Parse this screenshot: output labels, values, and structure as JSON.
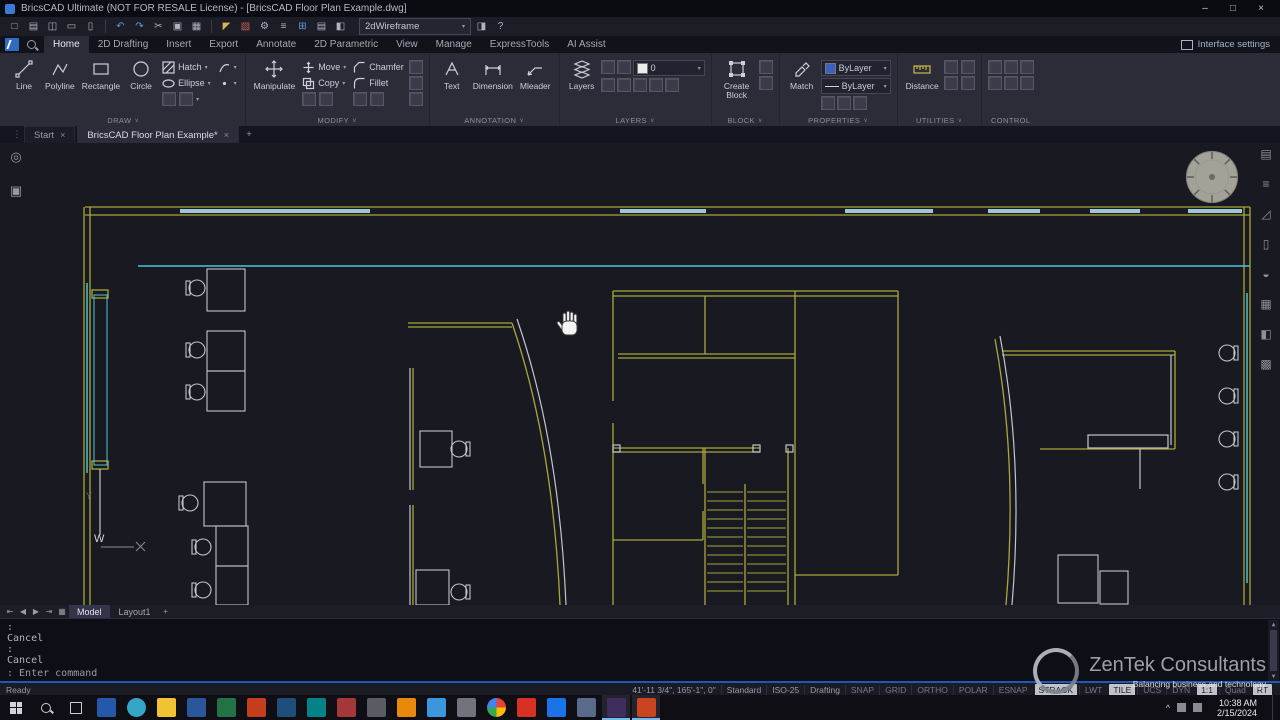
{
  "colors": {
    "wall_yellow": "#a8a838",
    "glass_cyan": "#49c5d8",
    "furniture_white": "#c4c4cc",
    "accent_blue": "#2058b8",
    "canvas_bg": "#191922"
  },
  "icons": {
    "minimize": "–",
    "maximize": "□",
    "close": "×",
    "caret": "▾",
    "chevron": "∨",
    "plus": "+",
    "tab_close": "×",
    "handle": "⋮",
    "first": "⇤",
    "prev": "◀",
    "next": "▶",
    "last": "⇥",
    "grid": "▦",
    "up": "▲",
    "down": "▼",
    "help": "?",
    "tray_chevron": "^"
  },
  "titlebar": {
    "title": "BricsCAD Ultimate (NOT FOR RESALE License) - [BricsCAD Floor Plan Example.dwg]"
  },
  "qat": {
    "visual_style": "2dWireframe",
    "icons": [
      "□",
      "▤",
      "◫",
      "▭",
      "▯",
      "↶",
      "↷",
      "✂",
      "▣",
      "▦"
    ],
    "icons_mid": [
      "◤",
      "▧",
      "⚙",
      "≡",
      "⊞",
      "▤",
      "◧"
    ],
    "icons_end": [
      "◨",
      "?"
    ]
  },
  "ribbon": {
    "tabs": [
      "Home",
      "2D Drafting",
      "Insert",
      "Export",
      "Annotate",
      "2D Parametric",
      "View",
      "Manage",
      "ExpressTools",
      "AI Assist"
    ],
    "interface_settings": "Interface settings",
    "draw": {
      "name": "DRAW",
      "line": "Line",
      "polyline": "Polyline",
      "rectangle": "Rectangle",
      "circle": "Circle",
      "hatch": "Hatch",
      "ellipse": "Ellipse"
    },
    "modify": {
      "name": "MODIFY",
      "manipulate": "Manipulate",
      "move": "Move",
      "copy": "Copy",
      "chamfer": "Chamfer",
      "fillet": "Fillet"
    },
    "annotation": {
      "name": "ANNOTATION",
      "text": "Text",
      "dimension": "Dimension",
      "mleader": "Mleader"
    },
    "layers": {
      "name": "LAYERS",
      "layers": "Layers",
      "current_layer": "0"
    },
    "block": {
      "name": "BLOCK",
      "create_block": "Create Block"
    },
    "properties": {
      "name": "PROPERTIES",
      "match": "Match",
      "color_bylayer": "ByLayer",
      "line_bylayer": "ByLayer"
    },
    "utilities": {
      "name": "UTILITIES",
      "distance": "Distance"
    },
    "control": {
      "name": "CONTROL"
    }
  },
  "doc_tabs": {
    "start": "Start",
    "drawing": "BricsCAD Floor Plan Example*"
  },
  "canvas": {
    "w_label": "W",
    "y_label": "Y"
  },
  "panel": {
    "right_icons": [
      "▤",
      "≡",
      "◿",
      "▯",
      "◒",
      "▦",
      "◧",
      "▩"
    ],
    "left_icons": [
      "◎",
      "▣"
    ]
  },
  "layout_bar": {
    "model": "Model",
    "layout1": "Layout1"
  },
  "command": {
    "lines": [
      ":",
      "Cancel",
      ":",
      "Cancel"
    ],
    "prompt": ": Enter command"
  },
  "status": {
    "ready": "Ready",
    "coords": "41'-11 3/4\", 165'-1\", 0\"",
    "style": "Standard",
    "dim_style": "ISO-25",
    "workspace": "Drafting",
    "toggles": [
      "SNAP",
      "GRID",
      "ORTHO",
      "POLAR",
      "ESNAP",
      "STRACK",
      "LWT",
      "TILE",
      "UCS",
      "DYN",
      "1:1",
      "Quad",
      "RT"
    ]
  },
  "watermark": {
    "name": "ZenTek Consultants",
    "tagline": "Balancing business and technology"
  },
  "taskbar": {
    "time": "10:38 AM",
    "date": "2/15/2024"
  }
}
